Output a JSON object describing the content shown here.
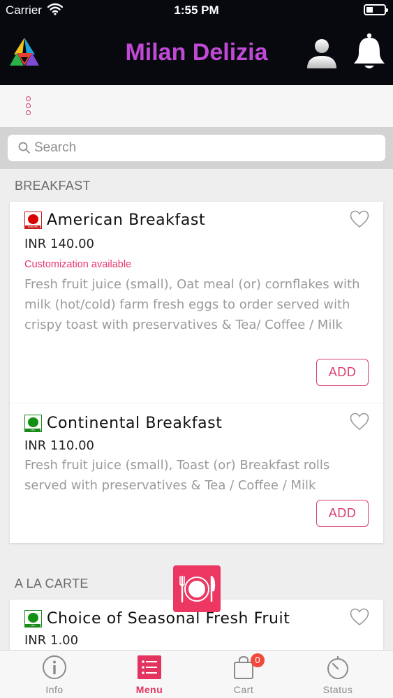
{
  "status_bar": {
    "carrier": "Carrier",
    "time": "1:55 PM"
  },
  "header": {
    "title": "Milan Delizia"
  },
  "search": {
    "placeholder": "Search"
  },
  "sections": [
    {
      "title": "BREAKFAST",
      "items": [
        {
          "name": "American Breakfast",
          "price": "INR 140.00",
          "diet": "non-veg",
          "customization": "Customization available",
          "description": "Fresh fruit juice (small), Oat meal (or) cornflakes with milk (hot/cold) farm fresh eggs to order served with crispy toast with preservatives & Tea/ Coffee / Milk",
          "add_label": "ADD"
        },
        {
          "name": "Continental Breakfast",
          "price": "INR 110.00",
          "diet": "veg",
          "description": "Fresh fruit juice (small), Toast (or) Breakfast rolls served with preservatives & Tea / Coffee / Milk",
          "add_label": "ADD"
        }
      ]
    },
    {
      "title": "A LA CARTE",
      "items": [
        {
          "name": "Choice of Seasonal Fresh Fruit",
          "price": "INR 1.00",
          "diet": "veg"
        }
      ]
    }
  ],
  "tabs": [
    {
      "label": "Info",
      "icon": "info-icon"
    },
    {
      "label": "Menu",
      "icon": "list-icon",
      "active": true
    },
    {
      "label": "Cart",
      "icon": "bag-icon",
      "badge": "0"
    },
    {
      "label": "Status",
      "icon": "timer-icon"
    }
  ],
  "colors": {
    "accent": "#e3335f",
    "brand_title": "#c04ad6",
    "header_bg": "#07090f",
    "veg": "#139113",
    "non_veg": "#d90000"
  }
}
